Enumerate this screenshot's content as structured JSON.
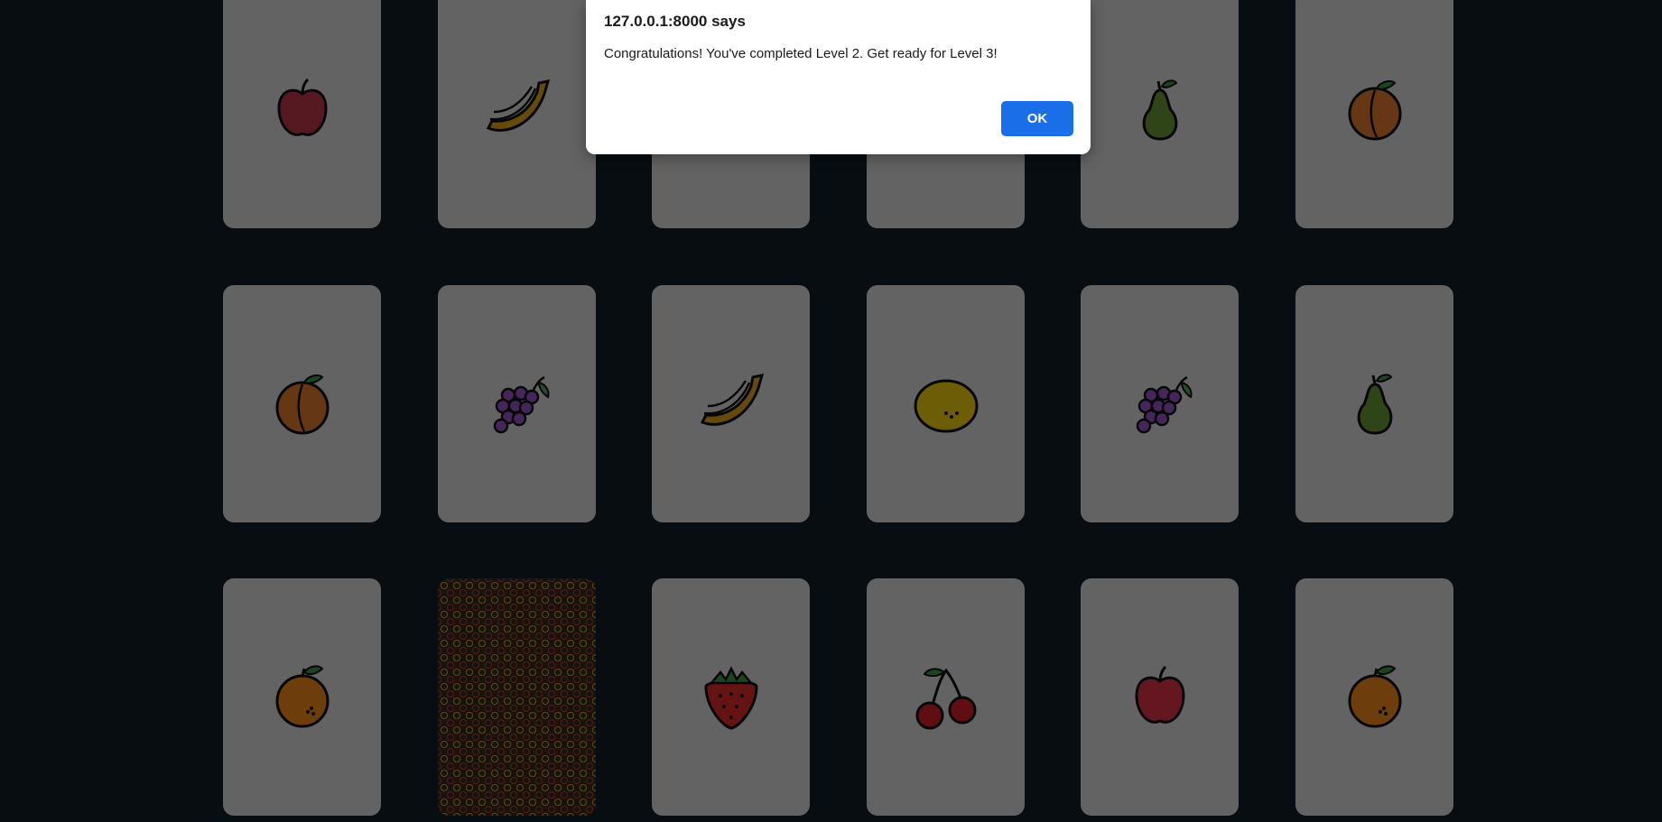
{
  "dialog": {
    "title": "127.0.0.1:8000 says",
    "message": "Congratulations! You've completed Level 2. Get ready for Level 3!",
    "ok_label": "OK"
  },
  "board": {
    "rows": [
      [
        "apple-icon",
        "banana-icon",
        "hidden-under-dialog",
        "hidden-under-dialog",
        "pear-icon",
        "peach-icon"
      ],
      [
        "peach-icon",
        "grapes-icon",
        "banana-icon",
        "lemon-icon",
        "grapes-icon",
        "pear-icon"
      ],
      [
        "orange-icon",
        "card-back",
        "strawberry-icon",
        "cherries-icon",
        "apple-icon",
        "orange-icon"
      ]
    ]
  },
  "colors": {
    "background": "#111d27",
    "card_face": "#dcdcdc",
    "ok_button": "#1a6ee8"
  }
}
